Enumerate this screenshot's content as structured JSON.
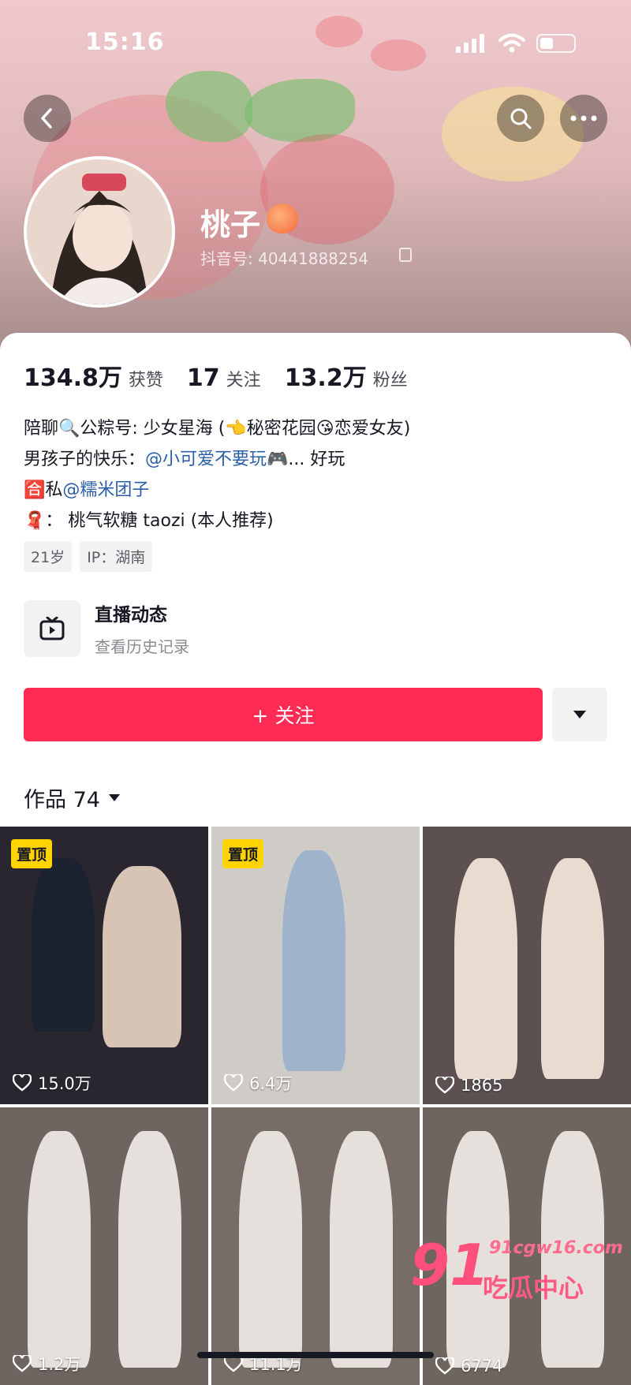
{
  "status_bar": {
    "time": "15:16"
  },
  "profile": {
    "name": "桃子",
    "douyin_id": "抖音号: 40441888254"
  },
  "stats": [
    {
      "value": "134.8万",
      "label": "获赞"
    },
    {
      "value": "17",
      "label": "关注"
    },
    {
      "value": "13.2万",
      "label": "粉丝"
    }
  ],
  "bio": {
    "line1": "陪聊🔍公粽号: 少女星海 (👈秘密花园😘恋爱女友)",
    "line2_prefix": "男孩子的快乐：",
    "line2_mention": "@小可爱不要玩🎮",
    "line2_suffix": "... 好玩",
    "line3_prefix": "🈴私",
    "line3_mention": "@糯米团子",
    "line4": "🧣： 桃气软糖 taozi (本人推荐)"
  },
  "tags": [
    "21岁",
    "IP：湖南"
  ],
  "live": {
    "title": "直播动态",
    "subtitle": "查看历史记录"
  },
  "follow_button": "+ 关注",
  "works_header": {
    "label": "作品 74"
  },
  "videos": [
    {
      "likes": "15.0万",
      "pinned": "置顶",
      "bg": "#2a2630"
    },
    {
      "likes": "6.4万",
      "pinned": "置顶",
      "bg": "#cfccc8"
    },
    {
      "likes": "1865",
      "pinned": "",
      "bg": "#5c5150"
    },
    {
      "likes": "1.2万",
      "pinned": "",
      "bg": "#6e6460"
    },
    {
      "likes": "11.1万",
      "pinned": "",
      "bg": "#776d66"
    },
    {
      "likes": "6774",
      "pinned": "",
      "bg": "#6f655f"
    }
  ],
  "watermark": {
    "num": "91",
    "text": "吃瓜中心",
    "url": "91cgw16.com"
  },
  "colors": {
    "accent": "#fe2c55",
    "mention": "#2b5ea8",
    "pin": "#ffd400"
  }
}
